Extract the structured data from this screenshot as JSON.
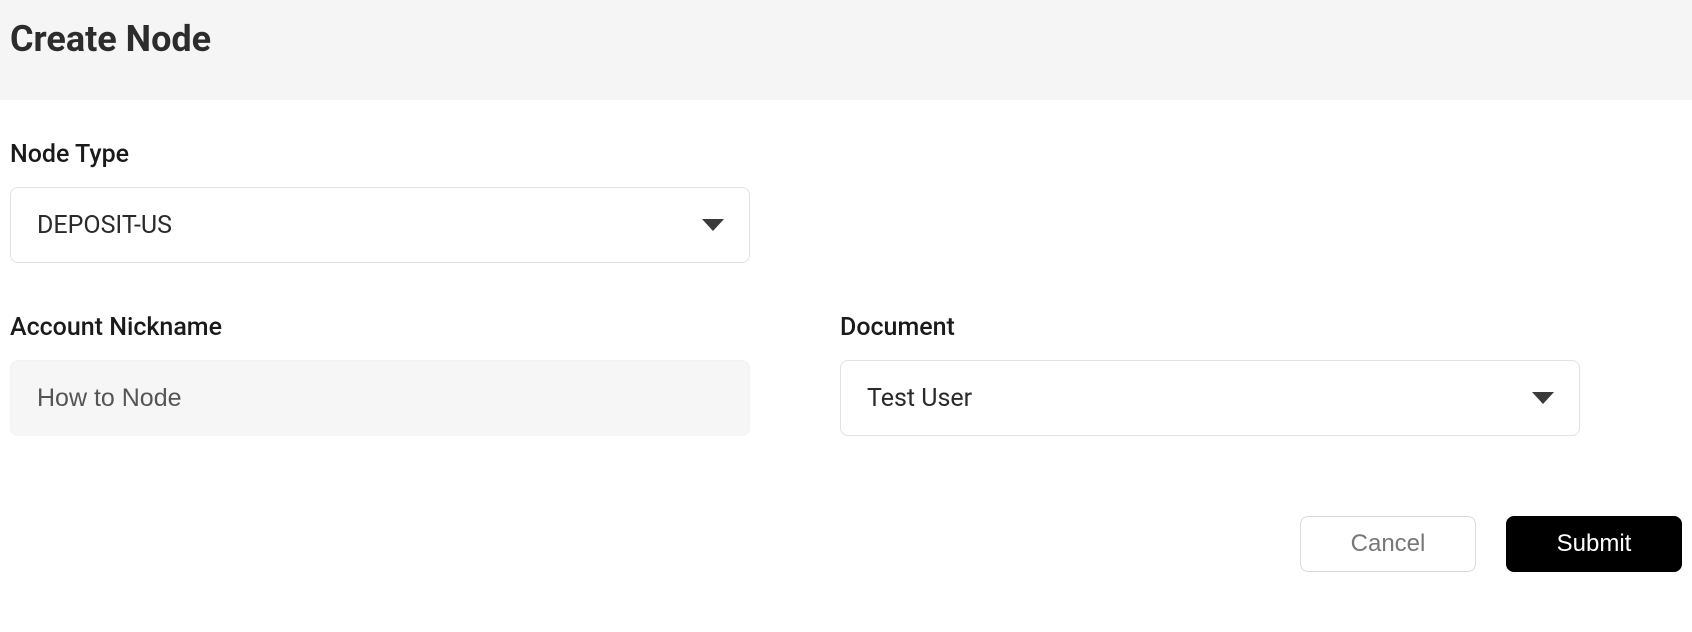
{
  "header": {
    "title": "Create Node"
  },
  "form": {
    "nodeType": {
      "label": "Node Type",
      "value": "DEPOSIT-US"
    },
    "accountNickname": {
      "label": "Account Nickname",
      "value": "How to Node"
    },
    "document": {
      "label": "Document",
      "value": "Test User"
    }
  },
  "buttons": {
    "cancel": "Cancel",
    "submit": "Submit"
  }
}
